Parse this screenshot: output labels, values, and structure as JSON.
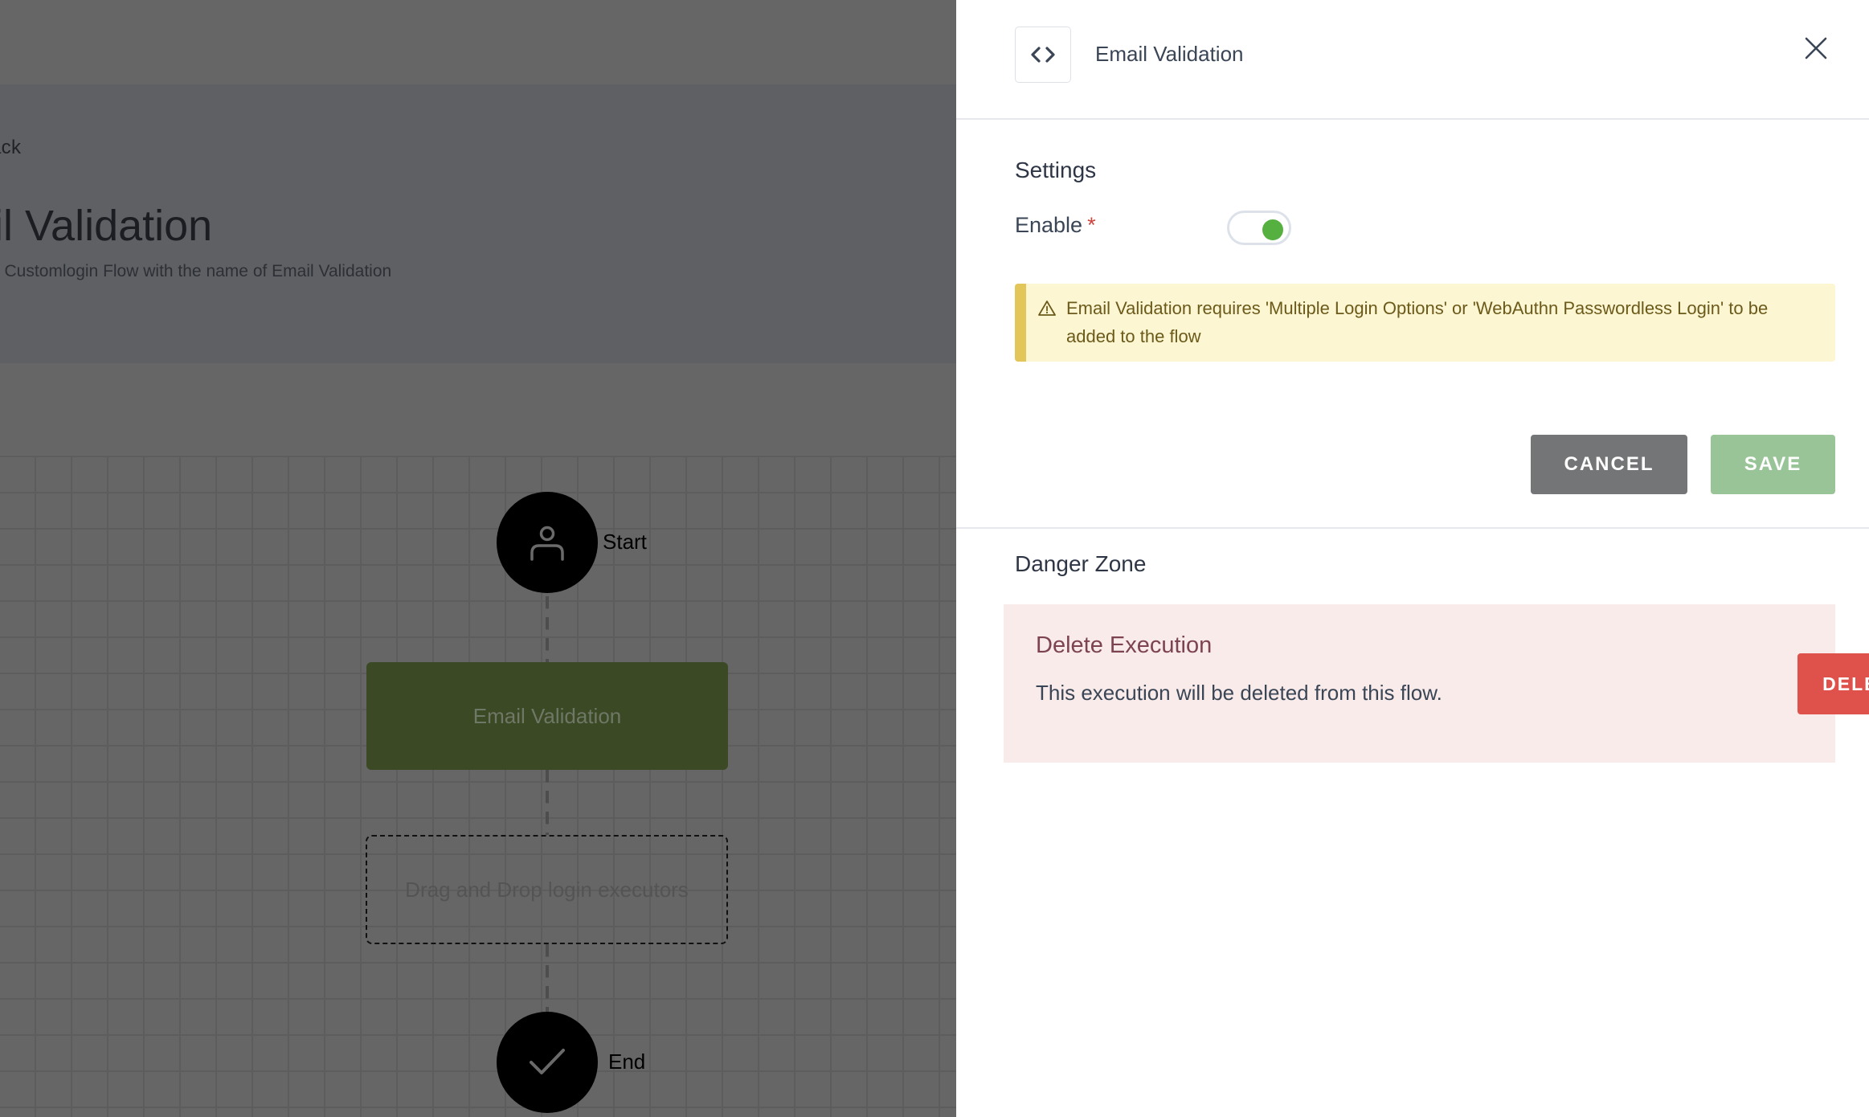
{
  "background_page": {
    "back_link": "ack",
    "title": "ail Validation",
    "subtitle": "e Customlogin Flow with the name of Email Validation",
    "flow": {
      "start_label": "Start",
      "executor_label": "Email Validation",
      "drop_zone_label": "Drag and Drop login executors",
      "end_label": "End",
      "executor_color": "#3b4924"
    }
  },
  "panel": {
    "title": "Email Validation",
    "header_icon": "code-brackets-icon",
    "close_icon": "close-icon",
    "settings": {
      "heading": "Settings",
      "enable_label": "Enable",
      "required_marker": "*",
      "enable_value": true,
      "toggle_color": "#55b03f"
    },
    "warning": {
      "icon": "warning-triangle-icon",
      "text": "Email Validation requires 'Multiple Login Options' or 'WebAuthn Passwordless Login' to be added to the flow",
      "accent": "#e3c659"
    },
    "actions": {
      "cancel_label": "CANCEL",
      "save_label": "SAVE"
    },
    "danger_zone": {
      "heading": "Danger Zone",
      "card_title": "Delete Execution",
      "card_text": "This execution will be deleted from this flow.",
      "delete_label": "DELETE",
      "delete_color": "#df524c"
    }
  }
}
